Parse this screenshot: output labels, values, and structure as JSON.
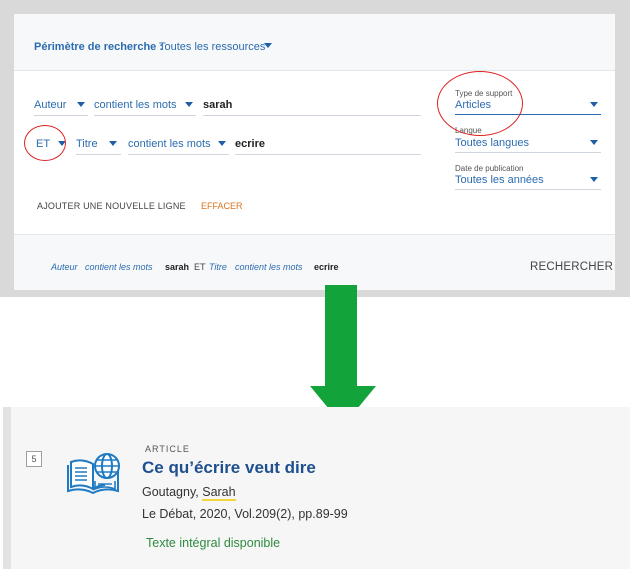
{
  "search": {
    "scope_label": "Périmètre de recherche :",
    "scope_value": "Toutes les ressources",
    "row1": {
      "field": "Auteur",
      "operator": "contient les mots",
      "term": "sarah"
    },
    "row2": {
      "boolean": "ET",
      "field": "Titre",
      "operator": "contient les mots",
      "term": "ecrire"
    },
    "add_line": "AJOUTER UNE NOUVELLE LIGNE",
    "clear": "EFFACER",
    "filters": {
      "support": {
        "label": "Type de support",
        "value": "Articles"
      },
      "language": {
        "label": "Langue",
        "value": "Toutes langues"
      },
      "date": {
        "label": "Date de publication",
        "value": "Toutes les années"
      }
    },
    "summary": {
      "f1": "Auteur",
      "op1": "contient les mots",
      "t1": "sarah",
      "bool": "ET",
      "f2": "Titre",
      "op2": "contient les mots",
      "t2": "ecrire"
    },
    "search_button": "RECHERCHER"
  },
  "result": {
    "number": "5",
    "type": "ARTICLE",
    "title": "Ce qu’écrire veut dire",
    "author_last": "Goutagny, ",
    "author_first": "Sarah",
    "source": "Le Débat, 2020, Vol.209(2), pp.89-99",
    "availability": "Texte intégral disponible",
    "icon": "open-book-globe-icon"
  },
  "colors": {
    "accent": "#2b6cb0",
    "arrow": "#12a33a",
    "highlight": "#f2d63a",
    "annotation": "#dd2222"
  }
}
